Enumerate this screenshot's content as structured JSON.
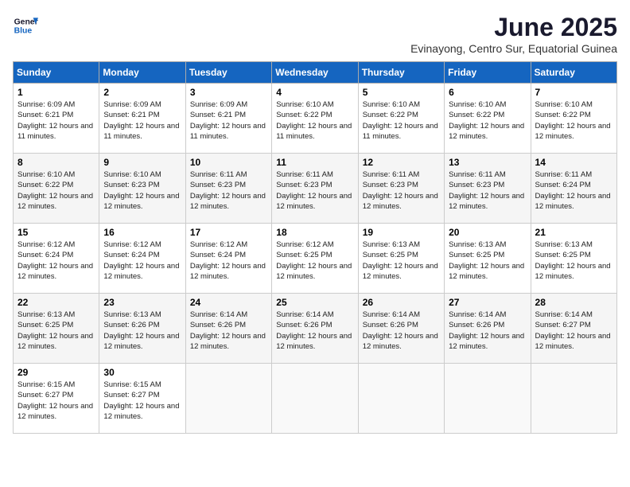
{
  "logo": {
    "line1": "General",
    "line2": "Blue"
  },
  "title": "June 2025",
  "location": "Evinayong, Centro Sur, Equatorial Guinea",
  "days_of_week": [
    "Sunday",
    "Monday",
    "Tuesday",
    "Wednesday",
    "Thursday",
    "Friday",
    "Saturday"
  ],
  "weeks": [
    [
      {
        "day": "1",
        "sunrise": "6:09 AM",
        "sunset": "6:21 PM",
        "daylight": "12 hours and 11 minutes."
      },
      {
        "day": "2",
        "sunrise": "6:09 AM",
        "sunset": "6:21 PM",
        "daylight": "12 hours and 11 minutes."
      },
      {
        "day": "3",
        "sunrise": "6:09 AM",
        "sunset": "6:21 PM",
        "daylight": "12 hours and 11 minutes."
      },
      {
        "day": "4",
        "sunrise": "6:10 AM",
        "sunset": "6:22 PM",
        "daylight": "12 hours and 11 minutes."
      },
      {
        "day": "5",
        "sunrise": "6:10 AM",
        "sunset": "6:22 PM",
        "daylight": "12 hours and 11 minutes."
      },
      {
        "day": "6",
        "sunrise": "6:10 AM",
        "sunset": "6:22 PM",
        "daylight": "12 hours and 12 minutes."
      },
      {
        "day": "7",
        "sunrise": "6:10 AM",
        "sunset": "6:22 PM",
        "daylight": "12 hours and 12 minutes."
      }
    ],
    [
      {
        "day": "8",
        "sunrise": "6:10 AM",
        "sunset": "6:22 PM",
        "daylight": "12 hours and 12 minutes."
      },
      {
        "day": "9",
        "sunrise": "6:10 AM",
        "sunset": "6:23 PM",
        "daylight": "12 hours and 12 minutes."
      },
      {
        "day": "10",
        "sunrise": "6:11 AM",
        "sunset": "6:23 PM",
        "daylight": "12 hours and 12 minutes."
      },
      {
        "day": "11",
        "sunrise": "6:11 AM",
        "sunset": "6:23 PM",
        "daylight": "12 hours and 12 minutes."
      },
      {
        "day": "12",
        "sunrise": "6:11 AM",
        "sunset": "6:23 PM",
        "daylight": "12 hours and 12 minutes."
      },
      {
        "day": "13",
        "sunrise": "6:11 AM",
        "sunset": "6:23 PM",
        "daylight": "12 hours and 12 minutes."
      },
      {
        "day": "14",
        "sunrise": "6:11 AM",
        "sunset": "6:24 PM",
        "daylight": "12 hours and 12 minutes."
      }
    ],
    [
      {
        "day": "15",
        "sunrise": "6:12 AM",
        "sunset": "6:24 PM",
        "daylight": "12 hours and 12 minutes."
      },
      {
        "day": "16",
        "sunrise": "6:12 AM",
        "sunset": "6:24 PM",
        "daylight": "12 hours and 12 minutes."
      },
      {
        "day": "17",
        "sunrise": "6:12 AM",
        "sunset": "6:24 PM",
        "daylight": "12 hours and 12 minutes."
      },
      {
        "day": "18",
        "sunrise": "6:12 AM",
        "sunset": "6:25 PM",
        "daylight": "12 hours and 12 minutes."
      },
      {
        "day": "19",
        "sunrise": "6:13 AM",
        "sunset": "6:25 PM",
        "daylight": "12 hours and 12 minutes."
      },
      {
        "day": "20",
        "sunrise": "6:13 AM",
        "sunset": "6:25 PM",
        "daylight": "12 hours and 12 minutes."
      },
      {
        "day": "21",
        "sunrise": "6:13 AM",
        "sunset": "6:25 PM",
        "daylight": "12 hours and 12 minutes."
      }
    ],
    [
      {
        "day": "22",
        "sunrise": "6:13 AM",
        "sunset": "6:25 PM",
        "daylight": "12 hours and 12 minutes."
      },
      {
        "day": "23",
        "sunrise": "6:13 AM",
        "sunset": "6:26 PM",
        "daylight": "12 hours and 12 minutes."
      },
      {
        "day": "24",
        "sunrise": "6:14 AM",
        "sunset": "6:26 PM",
        "daylight": "12 hours and 12 minutes."
      },
      {
        "day": "25",
        "sunrise": "6:14 AM",
        "sunset": "6:26 PM",
        "daylight": "12 hours and 12 minutes."
      },
      {
        "day": "26",
        "sunrise": "6:14 AM",
        "sunset": "6:26 PM",
        "daylight": "12 hours and 12 minutes."
      },
      {
        "day": "27",
        "sunrise": "6:14 AM",
        "sunset": "6:26 PM",
        "daylight": "12 hours and 12 minutes."
      },
      {
        "day": "28",
        "sunrise": "6:14 AM",
        "sunset": "6:27 PM",
        "daylight": "12 hours and 12 minutes."
      }
    ],
    [
      {
        "day": "29",
        "sunrise": "6:15 AM",
        "sunset": "6:27 PM",
        "daylight": "12 hours and 12 minutes."
      },
      {
        "day": "30",
        "sunrise": "6:15 AM",
        "sunset": "6:27 PM",
        "daylight": "12 hours and 12 minutes."
      },
      null,
      null,
      null,
      null,
      null
    ]
  ]
}
